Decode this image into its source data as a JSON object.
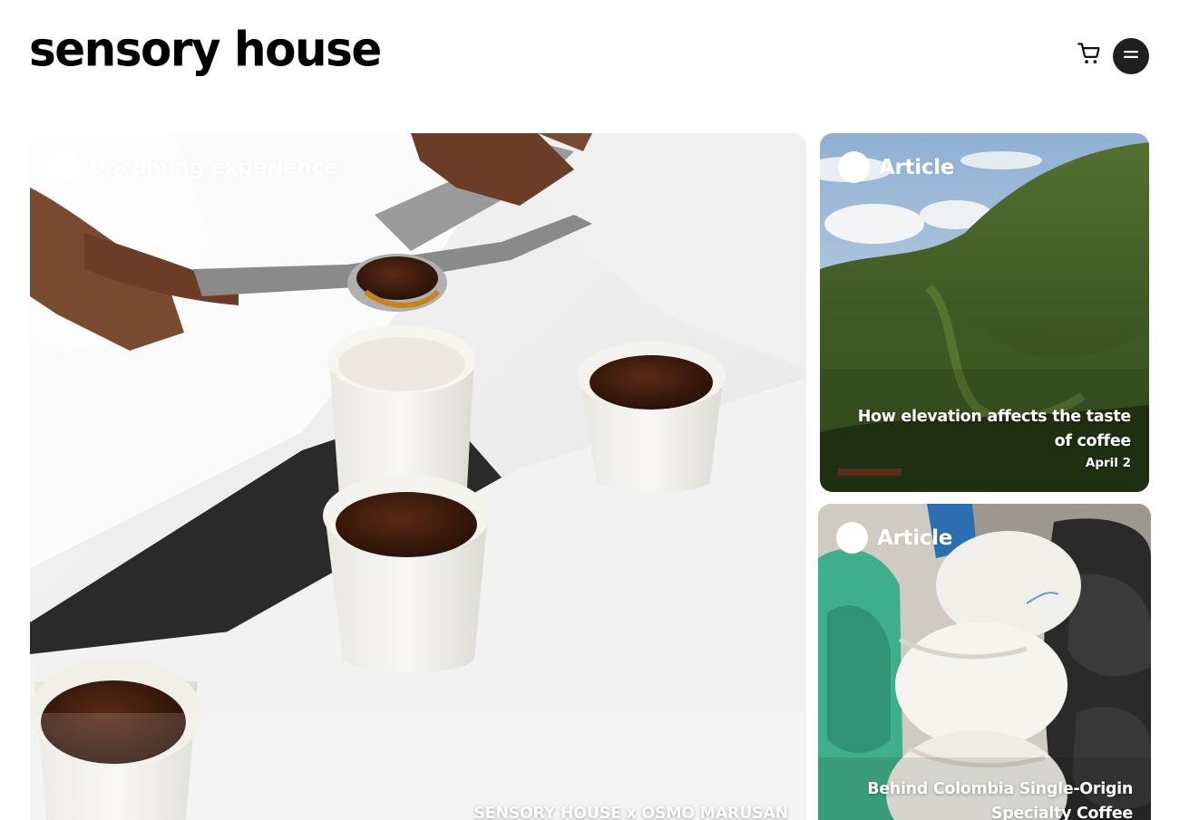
{
  "header": {
    "logo": "sensory house",
    "cart_icon": "shopping-cart-icon",
    "menu_icon": "hamburger-menu-icon"
  },
  "cards": {
    "main": {
      "badge": "Upcoming experience",
      "title": "SENSORY HOUSE x OSMO MARUSAN"
    },
    "article1": {
      "badge": "Article",
      "title": "How elevation affects the taste of coffee",
      "date": "April 2"
    },
    "article2": {
      "badge": "Article",
      "title": "Behind Colombia Single-Origin Specialty Coffee"
    }
  },
  "colors": {
    "background": "#ffffff",
    "text": "#000000",
    "menu_button": "#1f1f1f",
    "card_text": "#ffffff"
  }
}
